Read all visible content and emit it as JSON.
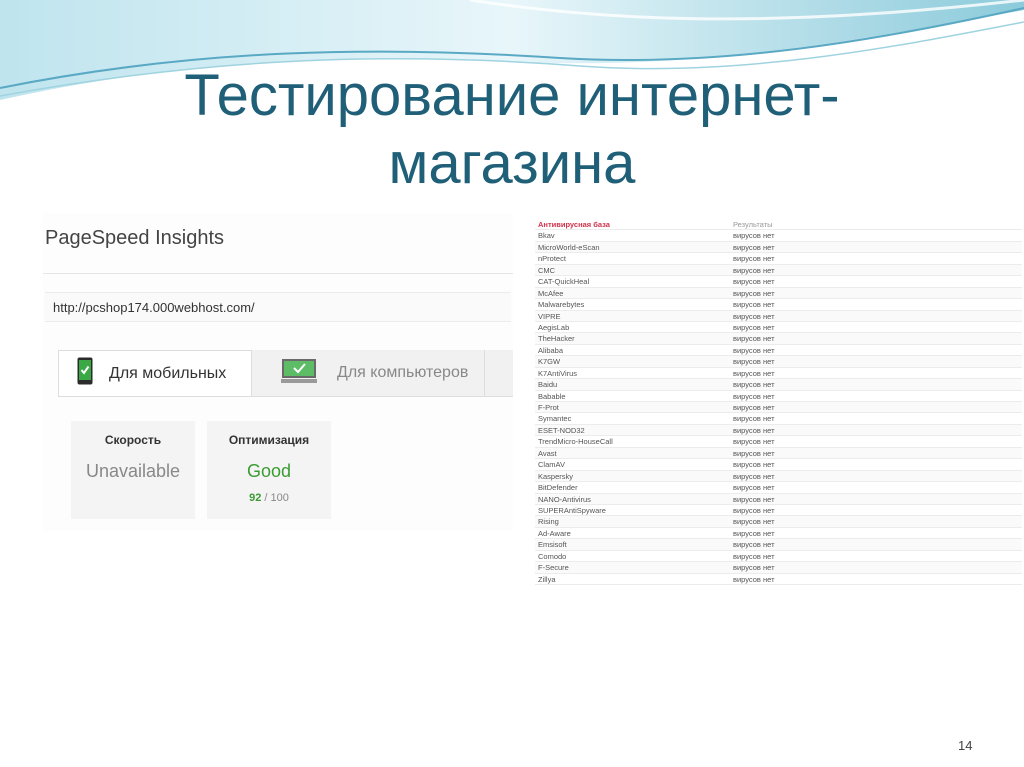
{
  "slide": {
    "title_line1": "Тестирование интернет-",
    "title_line2": "магазина",
    "page_number": "14"
  },
  "pagespeed": {
    "brand": "PageSpeed Insights",
    "url": "http://pcshop174.000webhost.com/",
    "tabs": {
      "mobile": "Для мобильных",
      "desktop": "Для компьютеров"
    },
    "speed": {
      "label": "Скорость",
      "value": "Unavailable"
    },
    "optimization": {
      "label": "Оптимизация",
      "value": "Good",
      "score": "92",
      "max": "/ 100"
    }
  },
  "antivirus": {
    "header": {
      "name": "Антивирусная база",
      "result": "Результаты"
    },
    "rows": [
      {
        "name": "Bkav",
        "result": "вирусов нет"
      },
      {
        "name": "MicroWorld-eScan",
        "result": "вирусов нет"
      },
      {
        "name": "nProtect",
        "result": "вирусов нет"
      },
      {
        "name": "CMC",
        "result": "вирусов нет"
      },
      {
        "name": "CAT-QuickHeal",
        "result": "вирусов нет"
      },
      {
        "name": "McAfee",
        "result": "вирусов нет"
      },
      {
        "name": "Malwarebytes",
        "result": "вирусов нет"
      },
      {
        "name": "VIPRE",
        "result": "вирусов нет"
      },
      {
        "name": "AegisLab",
        "result": "вирусов нет"
      },
      {
        "name": "TheHacker",
        "result": "вирусов нет"
      },
      {
        "name": "Alibaba",
        "result": "вирусов нет"
      },
      {
        "name": "K7GW",
        "result": "вирусов нет"
      },
      {
        "name": "K7AntiVirus",
        "result": "вирусов нет"
      },
      {
        "name": "Baidu",
        "result": "вирусов нет"
      },
      {
        "name": "Babable",
        "result": "вирусов нет"
      },
      {
        "name": "F-Prot",
        "result": "вирусов нет"
      },
      {
        "name": "Symantec",
        "result": "вирусов нет"
      },
      {
        "name": "ESET-NOD32",
        "result": "вирусов нет"
      },
      {
        "name": "TrendMicro-HouseCall",
        "result": "вирусов нет"
      },
      {
        "name": "Avast",
        "result": "вирусов нет"
      },
      {
        "name": "ClamAV",
        "result": "вирусов нет"
      },
      {
        "name": "Kaspersky",
        "result": "вирусов нет"
      },
      {
        "name": "BitDefender",
        "result": "вирусов нет"
      },
      {
        "name": "NANO-Antivirus",
        "result": "вирусов нет"
      },
      {
        "name": "SUPERAntiSpyware",
        "result": "вирусов нет"
      },
      {
        "name": "Rising",
        "result": "вирусов нет"
      },
      {
        "name": "Ad-Aware",
        "result": "вирусов нет"
      },
      {
        "name": "Emsisoft",
        "result": "вирусов нет"
      },
      {
        "name": "Comodo",
        "result": "вирусов нет"
      },
      {
        "name": "F-Secure",
        "result": "вирусов нет"
      },
      {
        "name": "Zillya",
        "result": "вирусов нет"
      }
    ]
  },
  "colors": {
    "title": "#1f5f78",
    "wave_light": "#cfe9ef",
    "wave_mid": "#9fd3e0",
    "wave_dark": "#3f8fb0",
    "good": "#3a9c33",
    "av_header": "#d0324a"
  },
  "icons": {
    "mobile_tab": "phone-check-icon",
    "desktop_tab": "monitor-check-icon"
  }
}
